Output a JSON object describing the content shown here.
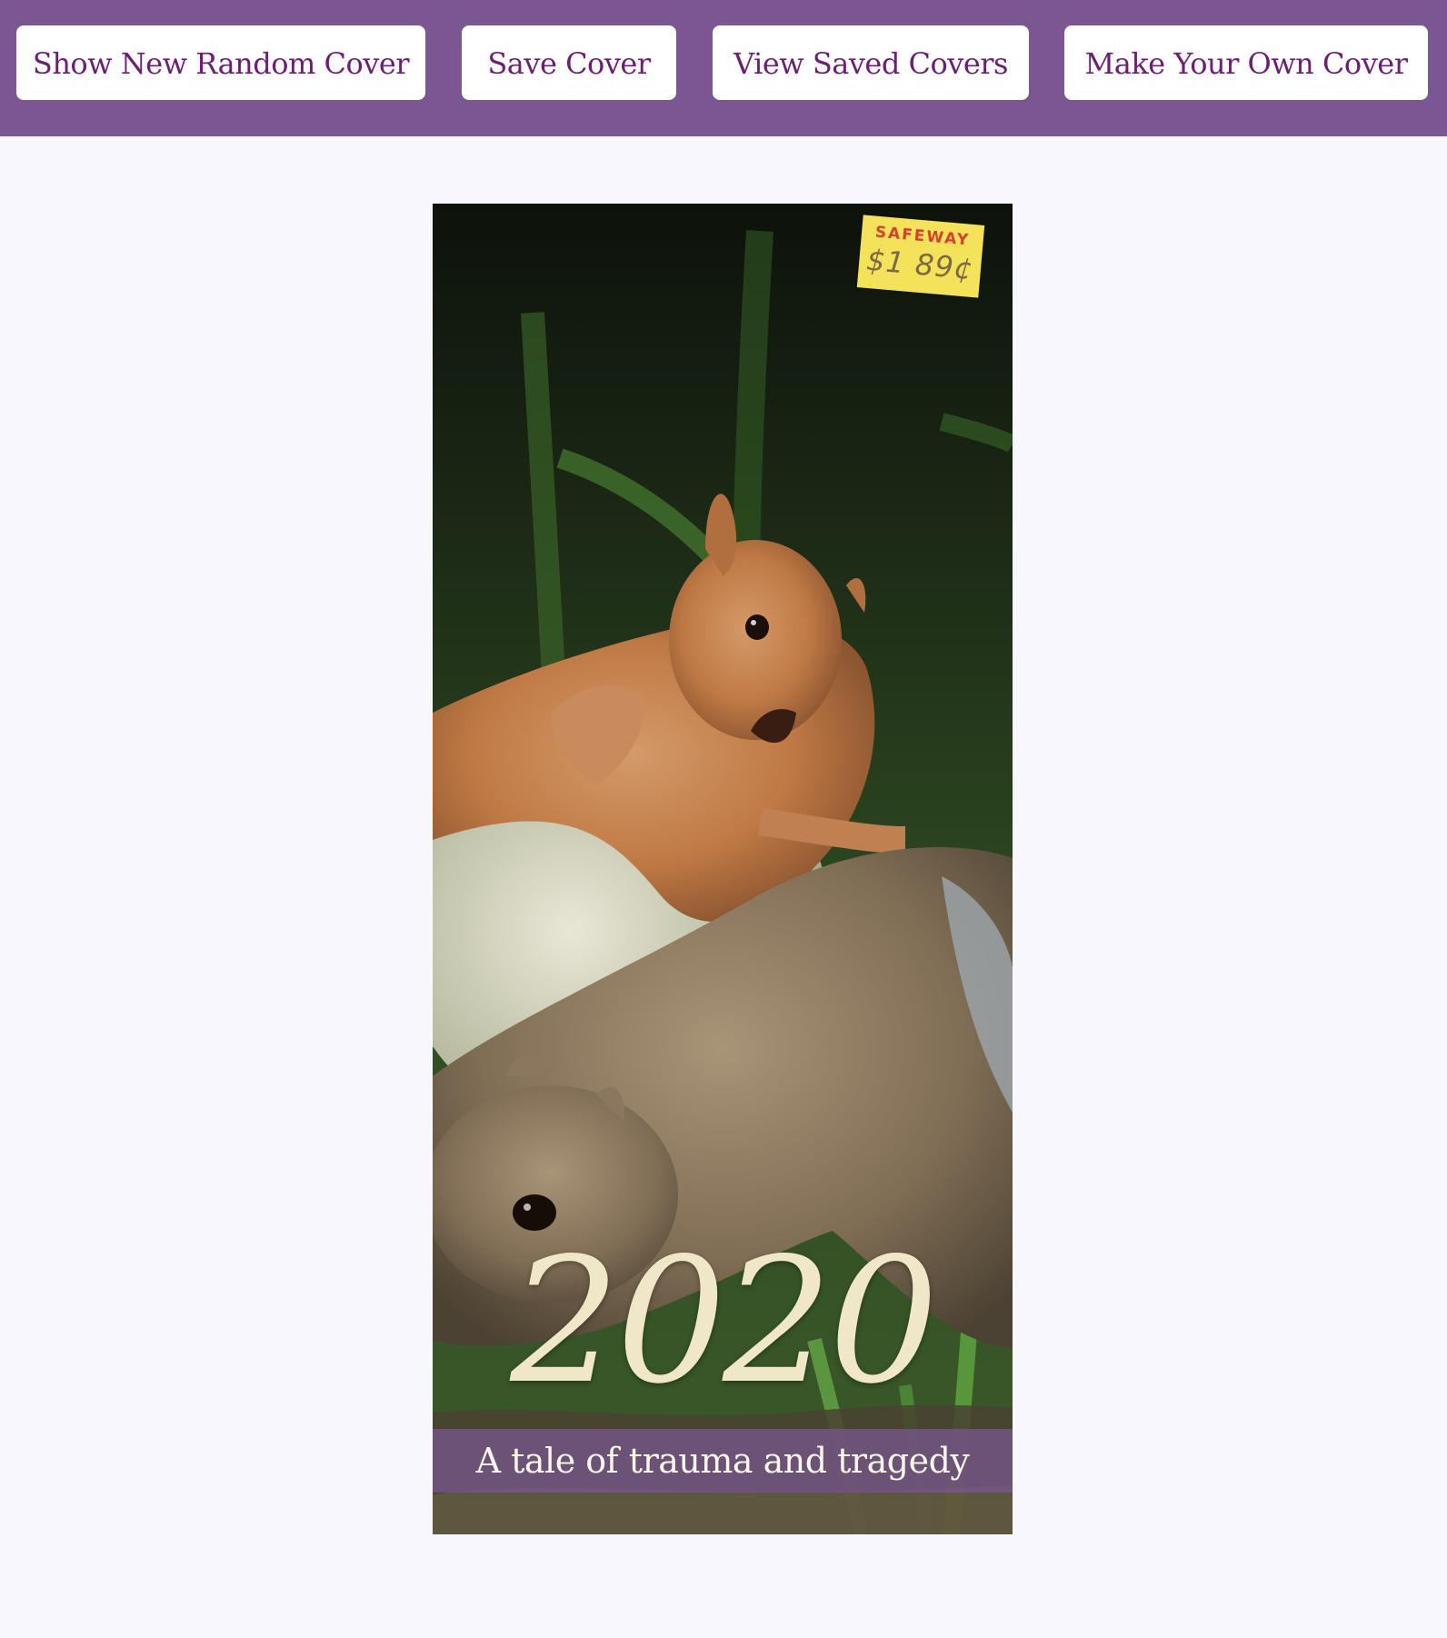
{
  "header": {
    "buttons": {
      "random": "Show New Random Cover",
      "save": "Save Cover",
      "view": "View Saved Covers",
      "make": "Make Your Own Cover"
    }
  },
  "cover": {
    "title": "2020",
    "tagline": "A tale of trauma and tragedy",
    "price_tag": {
      "store": "SAFEWAY",
      "price": "$1 89¢"
    }
  },
  "colors": {
    "header_bg": "#7a5792",
    "button_text": "#6b1f73",
    "page_bg": "#f8f7fd",
    "title_color": "#efe7c7"
  }
}
